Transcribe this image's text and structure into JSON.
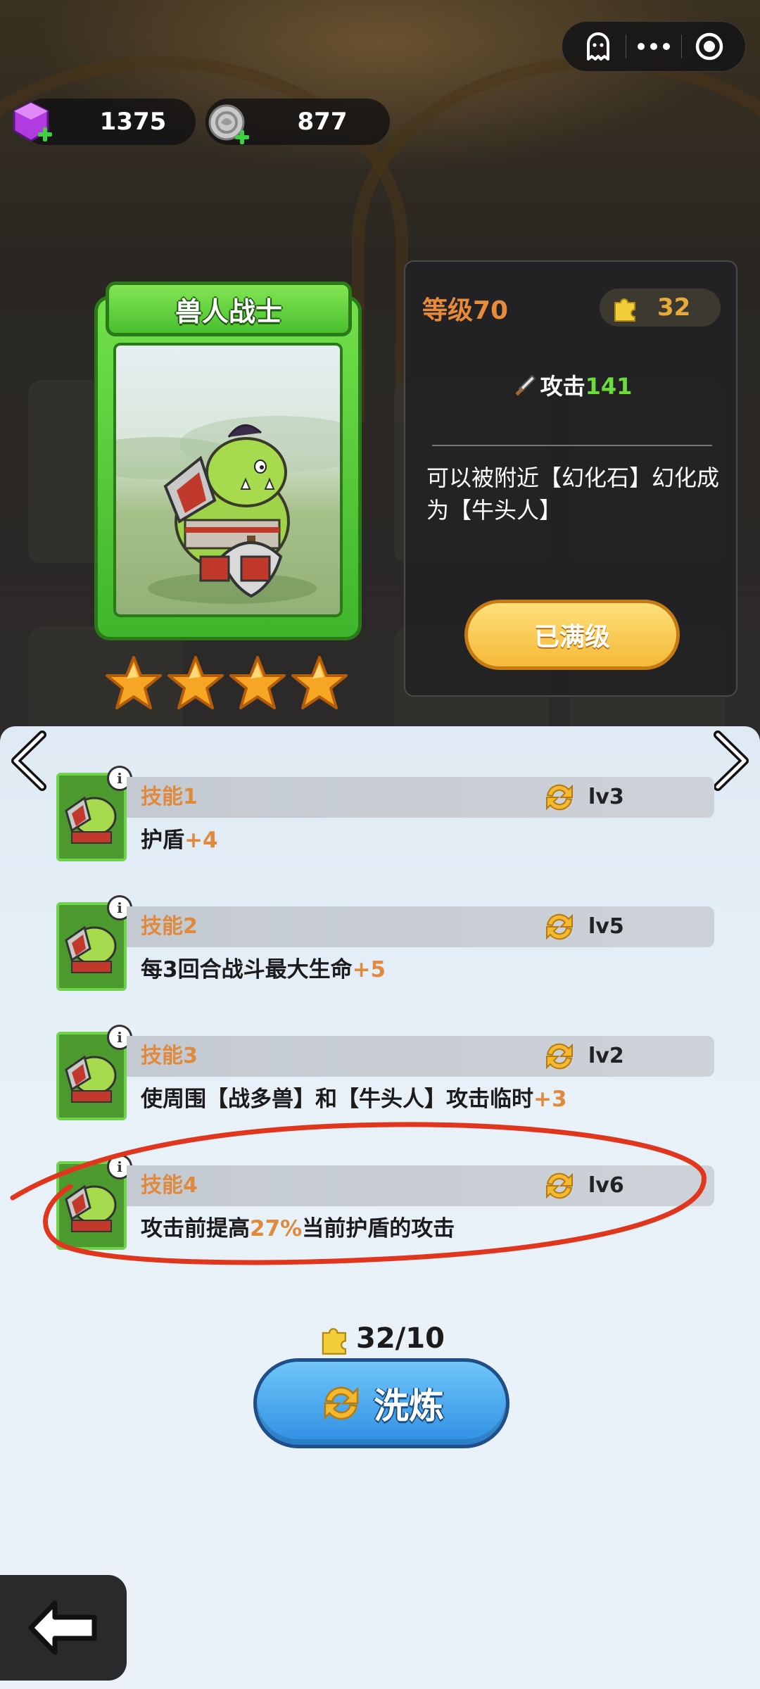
{
  "currency": {
    "gems": "1375",
    "coins": "877"
  },
  "capsule": {
    "icons": [
      "ghost-icon",
      "more-icon",
      "target-icon"
    ]
  },
  "hero": {
    "name": "兽人战士",
    "stars": 4
  },
  "info": {
    "level": "等级70",
    "pieces": "32",
    "attack_label": "攻击",
    "attack_value": "141",
    "description": "可以被附近【幻化石】幻化成为【牛头人】",
    "max_button": "已满级"
  },
  "skills": [
    {
      "name": "技能1",
      "level": "lv3",
      "desc_a": "护盾",
      "desc_hi": "+4",
      "desc_b": ""
    },
    {
      "name": "技能2",
      "level": "lv5",
      "desc_a": "每3回合战斗最大生命",
      "desc_hi": "+5",
      "desc_b": ""
    },
    {
      "name": "技能3",
      "level": "lv2",
      "desc_a": "使周围【战多兽】和【牛头人】攻击临时",
      "desc_hi": "+3",
      "desc_b": ""
    },
    {
      "name": "技能4",
      "level": "lv6",
      "desc_a": "攻击前提高",
      "desc_hi": "27%",
      "desc_b": "当前护盾的攻击"
    }
  ],
  "cost": "32/10",
  "refine_button": "洗炼",
  "colors": {
    "accent_orange": "#e08a3e",
    "green": "#6bdc3b",
    "blue_button": "#2f8fe3",
    "annotation_red": "#e0361e"
  }
}
